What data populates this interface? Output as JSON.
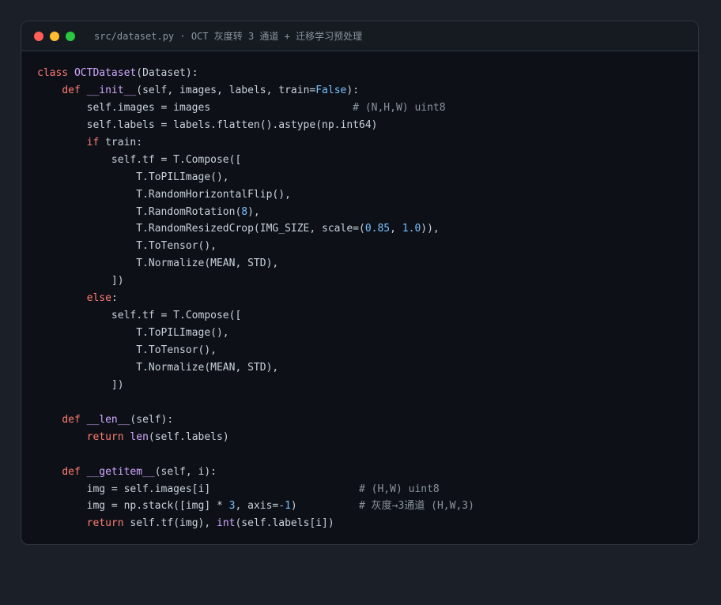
{
  "window": {
    "title": "src/dataset.py · OCT 灰度转 3 通道 + 迁移学习预处理",
    "dots": [
      {
        "name": "close",
        "color": "#ff5f57"
      },
      {
        "name": "minimize",
        "color": "#febc2e"
      },
      {
        "name": "maximize",
        "color": "#28c840"
      }
    ]
  },
  "colors": {
    "text": "#c9d1d9",
    "keyword": "#ff7b72",
    "function": "#d2a8ff",
    "constant": "#79c0ff",
    "comment": "#8b949e"
  },
  "code": {
    "lines": [
      [
        [
          "kw",
          "class "
        ],
        [
          "fn",
          "OCTDataset"
        ],
        [
          "t",
          "(Dataset):"
        ]
      ],
      [
        [
          "t",
          "    "
        ],
        [
          "kw",
          "def "
        ],
        [
          "fn",
          "__init__"
        ],
        [
          "t",
          "(self, images, labels, train="
        ],
        [
          "c",
          "False"
        ],
        [
          "t",
          "):"
        ]
      ],
      [
        [
          "t",
          "        self.images = images                       "
        ],
        [
          "cm",
          "# (N,H,W) uint8"
        ]
      ],
      [
        [
          "t",
          "        self.labels = labels.flatten().astype(np.int64)"
        ]
      ],
      [
        [
          "t",
          "        "
        ],
        [
          "kw",
          "if"
        ],
        [
          "t",
          " train:"
        ]
      ],
      [
        [
          "t",
          "            self.tf = T.Compose(["
        ]
      ],
      [
        [
          "t",
          "                T.ToPILImage(),"
        ]
      ],
      [
        [
          "t",
          "                T.RandomHorizontalFlip(),"
        ]
      ],
      [
        [
          "t",
          "                T.RandomRotation("
        ],
        [
          "c",
          "8"
        ],
        [
          "t",
          "),"
        ]
      ],
      [
        [
          "t",
          "                T.RandomResizedCrop(IMG_SIZE, scale=("
        ],
        [
          "c",
          "0.85"
        ],
        [
          "t",
          ", "
        ],
        [
          "c",
          "1.0"
        ],
        [
          "t",
          ")),"
        ]
      ],
      [
        [
          "t",
          "                T.ToTensor(),"
        ]
      ],
      [
        [
          "t",
          "                T.Normalize(MEAN, STD),"
        ]
      ],
      [
        [
          "t",
          "            ])"
        ]
      ],
      [
        [
          "t",
          "        "
        ],
        [
          "kw",
          "else"
        ],
        [
          "t",
          ":"
        ]
      ],
      [
        [
          "t",
          "            self.tf = T.Compose(["
        ]
      ],
      [
        [
          "t",
          "                T.ToPILImage(),"
        ]
      ],
      [
        [
          "t",
          "                T.ToTensor(),"
        ]
      ],
      [
        [
          "t",
          "                T.Normalize(MEAN, STD),"
        ]
      ],
      [
        [
          "t",
          "            ])"
        ]
      ],
      [],
      [
        [
          "t",
          "    "
        ],
        [
          "kw",
          "def "
        ],
        [
          "fn",
          "__len__"
        ],
        [
          "t",
          "(self):"
        ]
      ],
      [
        [
          "t",
          "        "
        ],
        [
          "kw",
          "return "
        ],
        [
          "fn",
          "len"
        ],
        [
          "t",
          "(self.labels)"
        ]
      ],
      [],
      [
        [
          "t",
          "    "
        ],
        [
          "kw",
          "def "
        ],
        [
          "fn",
          "__getitem__"
        ],
        [
          "t",
          "(self, i):"
        ]
      ],
      [
        [
          "t",
          "        img = self.images[i]                        "
        ],
        [
          "cm",
          "# (H,W) uint8"
        ]
      ],
      [
        [
          "t",
          "        img = np.stack([img] * "
        ],
        [
          "c",
          "3"
        ],
        [
          "t",
          ", axis="
        ],
        [
          "c",
          "-1"
        ],
        [
          "t",
          ")          "
        ],
        [
          "cm",
          "# 灰度→3通道 (H,W,3)"
        ]
      ],
      [
        [
          "t",
          "        "
        ],
        [
          "kw",
          "return "
        ],
        [
          "t",
          "self.tf(img), "
        ],
        [
          "fn",
          "int"
        ],
        [
          "t",
          "(self.labels[i])"
        ]
      ]
    ]
  }
}
